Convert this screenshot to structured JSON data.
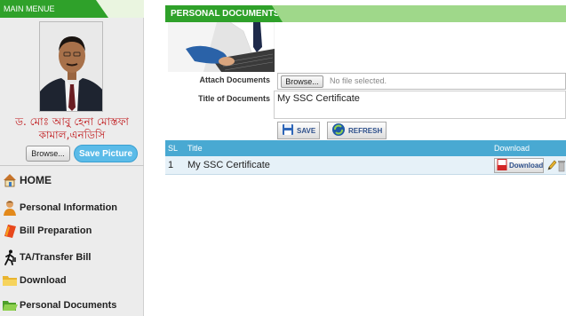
{
  "sidebar": {
    "header": "MAIN MENUE",
    "profile_name_line1": "ড. মোঃ আবু হেনা মোস্তফা",
    "profile_name_line2": "কামাল,এনডিসি",
    "browse_label": "Browse...",
    "save_picture_label": "Save Picture",
    "menu": [
      {
        "label": "HOME",
        "icon": "home-icon"
      },
      {
        "label": "Personal Information",
        "icon": "person-icon"
      },
      {
        "label": "Bill Preparation",
        "icon": "bill-icon"
      },
      {
        "label": "TA/Transfer Bill",
        "icon": "walking-icon"
      },
      {
        "label": "Download",
        "icon": "folder-icon"
      },
      {
        "label": "Personal Documents",
        "icon": "folder-open-icon"
      }
    ]
  },
  "main": {
    "header": "PERSONAL DOCUMENTS",
    "attach_label": "Attach Documents",
    "file_browse_label": "Browse...",
    "file_status": "No file selected.",
    "title_label": "Title of Documents",
    "title_value": "My SSC Certificate",
    "save_label": "SAVE",
    "refresh_label": "REFRESH",
    "table": {
      "columns": [
        "SL",
        "Title",
        "Download"
      ],
      "rows": [
        {
          "sl": "1",
          "title": "My SSC Certificate",
          "download_label": "Download"
        }
      ]
    }
  },
  "colors": {
    "tab_green": "#2fa12a",
    "header_light_green": "#9fd88a",
    "grid_header_blue": "#49a9d2",
    "name_red": "#c0181b",
    "save_picture_blue": "#5bbbe8"
  }
}
